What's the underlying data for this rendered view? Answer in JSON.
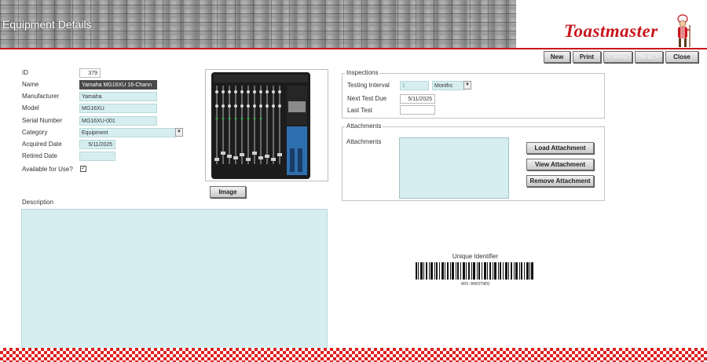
{
  "header": {
    "title": "Equipment Details",
    "logo_text": "Toastmaster"
  },
  "toolbar": {
    "new": "New",
    "print": "Print",
    "prev": "< Prev",
    "next": "Next >",
    "close": "Close"
  },
  "form": {
    "id_label": "ID",
    "id_value": "379",
    "name_label": "Name",
    "name_value": "Yamaha MG16XU 16-Chann",
    "manufacturer_label": "Manufacturer",
    "manufacturer_value": "Yamaha",
    "model_label": "Model",
    "model_value": "MG16XU",
    "serial_label": "Serial Number",
    "serial_value": "MG16XU-001",
    "category_label": "Category",
    "category_value": "Equipment",
    "acquired_label": "Acquired Date",
    "acquired_value": "5/11/2025",
    "retired_label": "Retired Date",
    "retired_value": "",
    "available_label": "Available for Use?",
    "available_checked": true,
    "description_label": "Description",
    "description_value": ""
  },
  "image_button": "Image",
  "inspections": {
    "legend": "Inspections",
    "testing_interval_label": "Testing Interval",
    "testing_interval_value": "1",
    "interval_unit": "Months",
    "next_test_label": "Next Test Due",
    "next_test_value": "5/11/2025",
    "last_test_label": "Last Test",
    "last_test_value": ""
  },
  "attachments": {
    "legend": "Attachments",
    "label": "Attachments",
    "load": "Load Attachment",
    "view": "View Attachment",
    "remove": "Remove Attachment"
  },
  "barcode": {
    "title": "Unique Identifier",
    "text": "003-000379EQ"
  },
  "colors": {
    "accent": "#c8161d",
    "field_bg": "#d6eef0",
    "checker": "#e02020"
  },
  "icons": {
    "checkbox": "checkmark-icon",
    "dropdown": "chevron-down-icon"
  }
}
